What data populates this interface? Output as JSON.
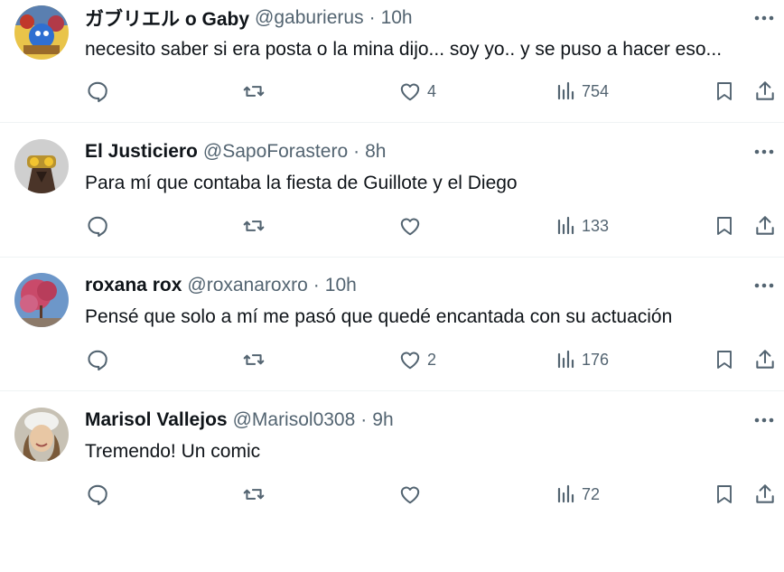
{
  "colors": {
    "text_primary": "#0f1419",
    "text_secondary": "#536471",
    "divider": "#eff3f4",
    "background": "#ffffff"
  },
  "icons": {
    "reply": "reply-icon",
    "retweet": "retweet-icon",
    "like": "heart-icon",
    "views": "views-icon",
    "bookmark": "bookmark-icon",
    "share": "share-icon",
    "more": "more-icon"
  },
  "tweets": [
    {
      "display_name": "ガブリエル o Gaby",
      "handle": "@gaburierus",
      "separator": "·",
      "time": "10h",
      "text": "necesito saber si era posta o la mina dijo... soy yo.. y se puso a hacer eso...",
      "likes": "4",
      "views": "754"
    },
    {
      "display_name": "El Justiciero",
      "handle": "@SapoForastero",
      "separator": "·",
      "time": "8h",
      "text": "Para mí que contaba la fiesta de Guillote y el Diego",
      "likes": "",
      "views": "133"
    },
    {
      "display_name": "roxana rox",
      "handle": "@roxanaroxro",
      "separator": "·",
      "time": "10h",
      "text": "Pensé que solo a mí me pasó que quedé encantada con su actuación",
      "likes": "2",
      "views": "176"
    },
    {
      "display_name": "Marisol Vallejos",
      "handle": "@Marisol0308",
      "separator": "·",
      "time": "9h",
      "text": "Tremendo! Un comic",
      "likes": "",
      "views": "72"
    }
  ]
}
